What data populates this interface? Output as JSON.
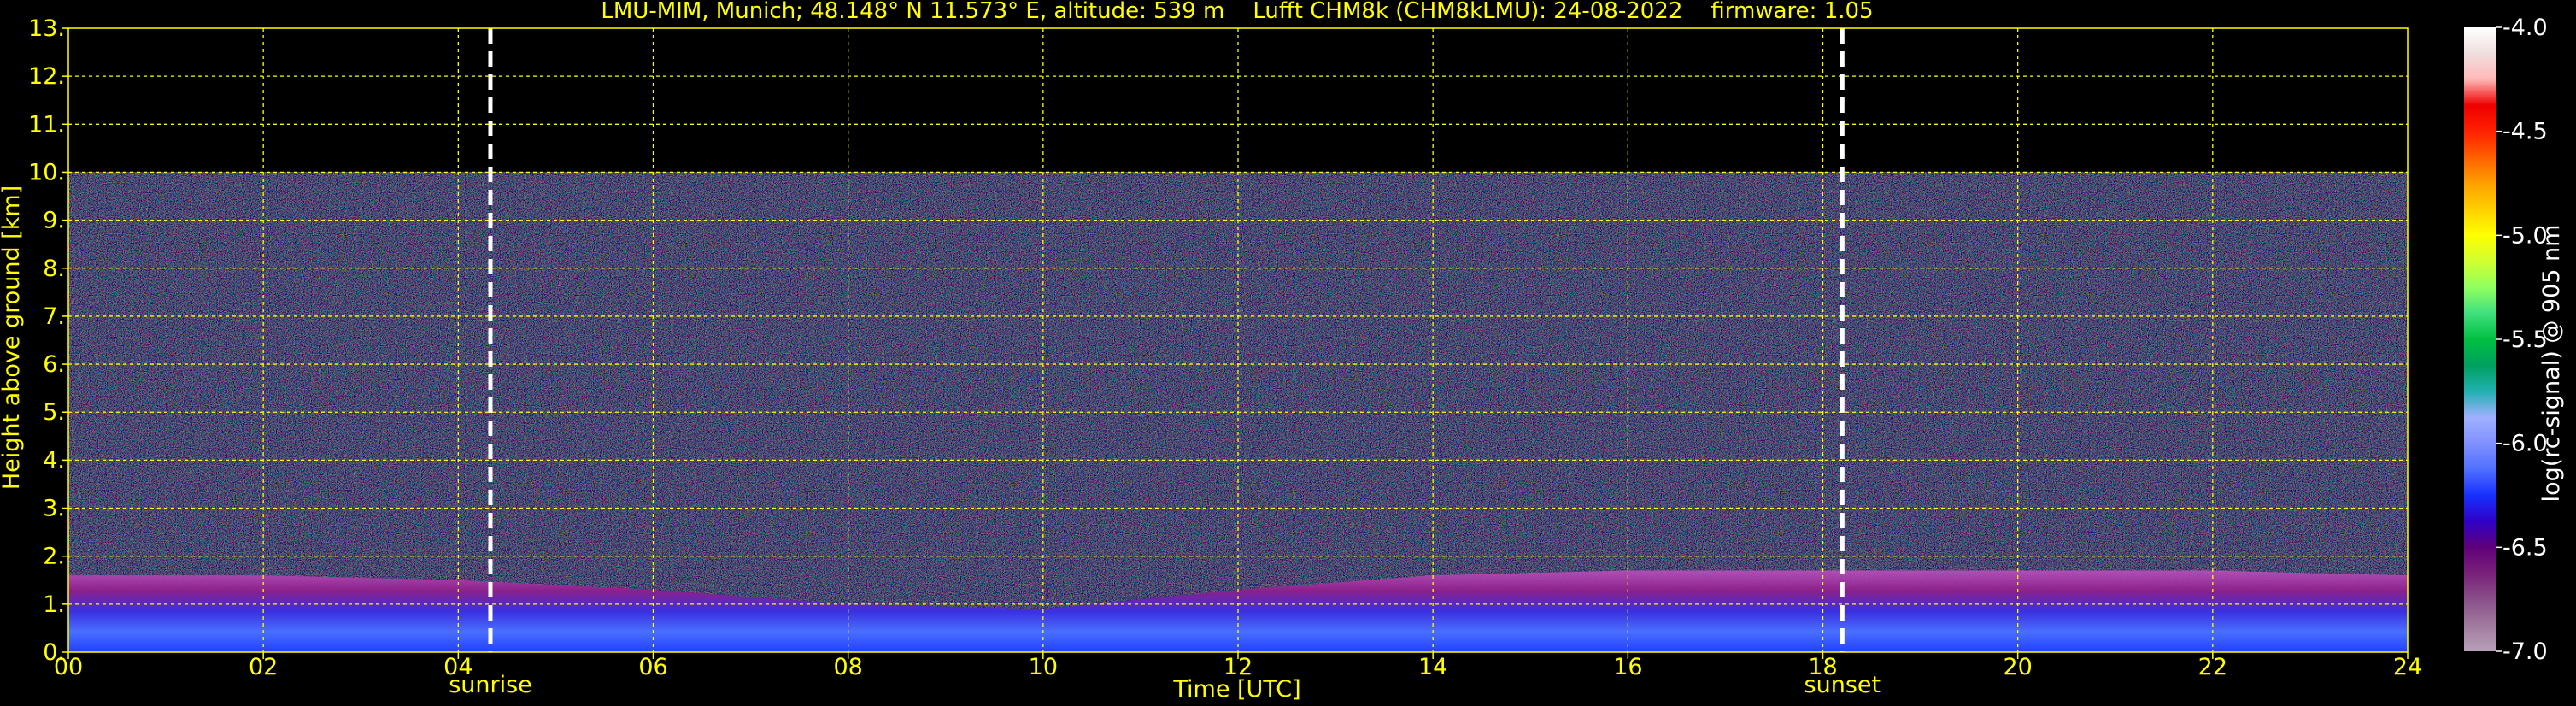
{
  "chart_data": {
    "type": "heatmap",
    "title": "LMU-MIM, Munich; 48.148° N 11.573° E, altitude: 539 m    Lufft CHM8k (CHM8kLMU): 24-08-2022    firmware: 1.05",
    "xlabel": "Time [UTC]",
    "ylabel": "Height above ground [km]",
    "xlim": [
      0,
      24
    ],
    "ylim": [
      0,
      13
    ],
    "x_ticks": [
      "00",
      "02",
      "04",
      "06",
      "08",
      "10",
      "12",
      "14",
      "16",
      "18",
      "20",
      "22",
      "24"
    ],
    "y_ticks": [
      "0.",
      "1.",
      "2.",
      "3.",
      "4.",
      "5.",
      "6.",
      "7.",
      "8.",
      "9.",
      "10.",
      "11.",
      "12.",
      "13."
    ],
    "grid": true,
    "signal_top_km": 10,
    "events": [
      {
        "label": "sunrise",
        "time": 4.33
      },
      {
        "label": "sunset",
        "time": 18.2
      }
    ],
    "boundary_layer": {
      "times": [
        0,
        2,
        4,
        6,
        8,
        10,
        12,
        14,
        16,
        18,
        20,
        22,
        24
      ],
      "layer_top_km": [
        1.6,
        1.6,
        1.5,
        1.3,
        1.0,
        0.9,
        1.3,
        1.6,
        1.7,
        1.7,
        1.7,
        1.7,
        1.6
      ]
    },
    "colorbar": {
      "label": "log(rc-signal) @ 905 nm",
      "range": [
        -7.0,
        -4.0
      ],
      "ticks": [
        "-4.0",
        "-4.5",
        "-5.0",
        "-5.5",
        "-6.0",
        "-6.5",
        "-7.0"
      ],
      "colors": [
        "#b8a0b8",
        "#a07aa0",
        "#8a508a",
        "#7a207a",
        "#60007a",
        "#3000c8",
        "#1830ff",
        "#5070ff",
        "#8090ff",
        "#a0b0ff",
        "#20b0b0",
        "#00a060",
        "#00c040",
        "#40e080",
        "#90ff60",
        "#d0ff30",
        "#ffff00",
        "#ffd000",
        "#ffa000",
        "#ff6000",
        "#ff2000",
        "#ee0000",
        "#ffb8b8",
        "#f0dede",
        "#ffffff"
      ]
    }
  }
}
